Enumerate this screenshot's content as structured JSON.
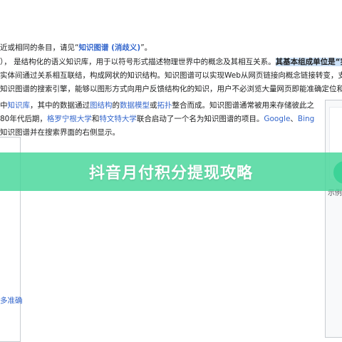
{
  "article": {
    "hatnote": {
      "prefix": "近或相同的条目，请见“",
      "link": "知识图谱 (消歧义)",
      "suffix": "”。"
    },
    "para1": {
      "line1": {
        "a": "）， 是结构化的语义知识库，用于以符号形式描述物理世界中的概念及其相互关系。",
        "hl": "其基本组成单位是“实"
      },
      "line2": "实体间通过关系相互联结，构成网状的知识结构。知识图谱可以实现Web从网页链接向概念链接转变，支持",
      "line3": "知识图谱的搜索引擎，能够以图形方式向用户反馈结构化的知识，用户不必浏览大量网页即能准确定位和深"
    },
    "para2": {
      "line1": {
        "a": "中",
        "link1": "知识库",
        "b": "，其中的数据通过",
        "link2": "图结构",
        "c": "的",
        "link3": "数据模型",
        "d": "或",
        "link4": "拓扑",
        "e": "整合而成。知识图谱通常被用来存储彼此之"
      },
      "line2": {
        "a": "80年代后期，",
        "link1": "格罗宁根大学",
        "b": "和",
        "link2": "特文特大学",
        "c": "联合启动了一个名为知识图谱的项目。",
        "link3": "Google",
        "d": "、",
        "link4": "Bing"
      },
      "line3": "知识图谱并在搜索界面的右侧显示。"
    },
    "left_box_text": "多准确",
    "right_caption": "示例"
  },
  "banner": {
    "title": "抖音月付积分提现攻略"
  },
  "colors": {
    "link": "#3366cc",
    "highlight": "#cde2f8",
    "banner": "#44d698",
    "circle": "#18c98f"
  }
}
